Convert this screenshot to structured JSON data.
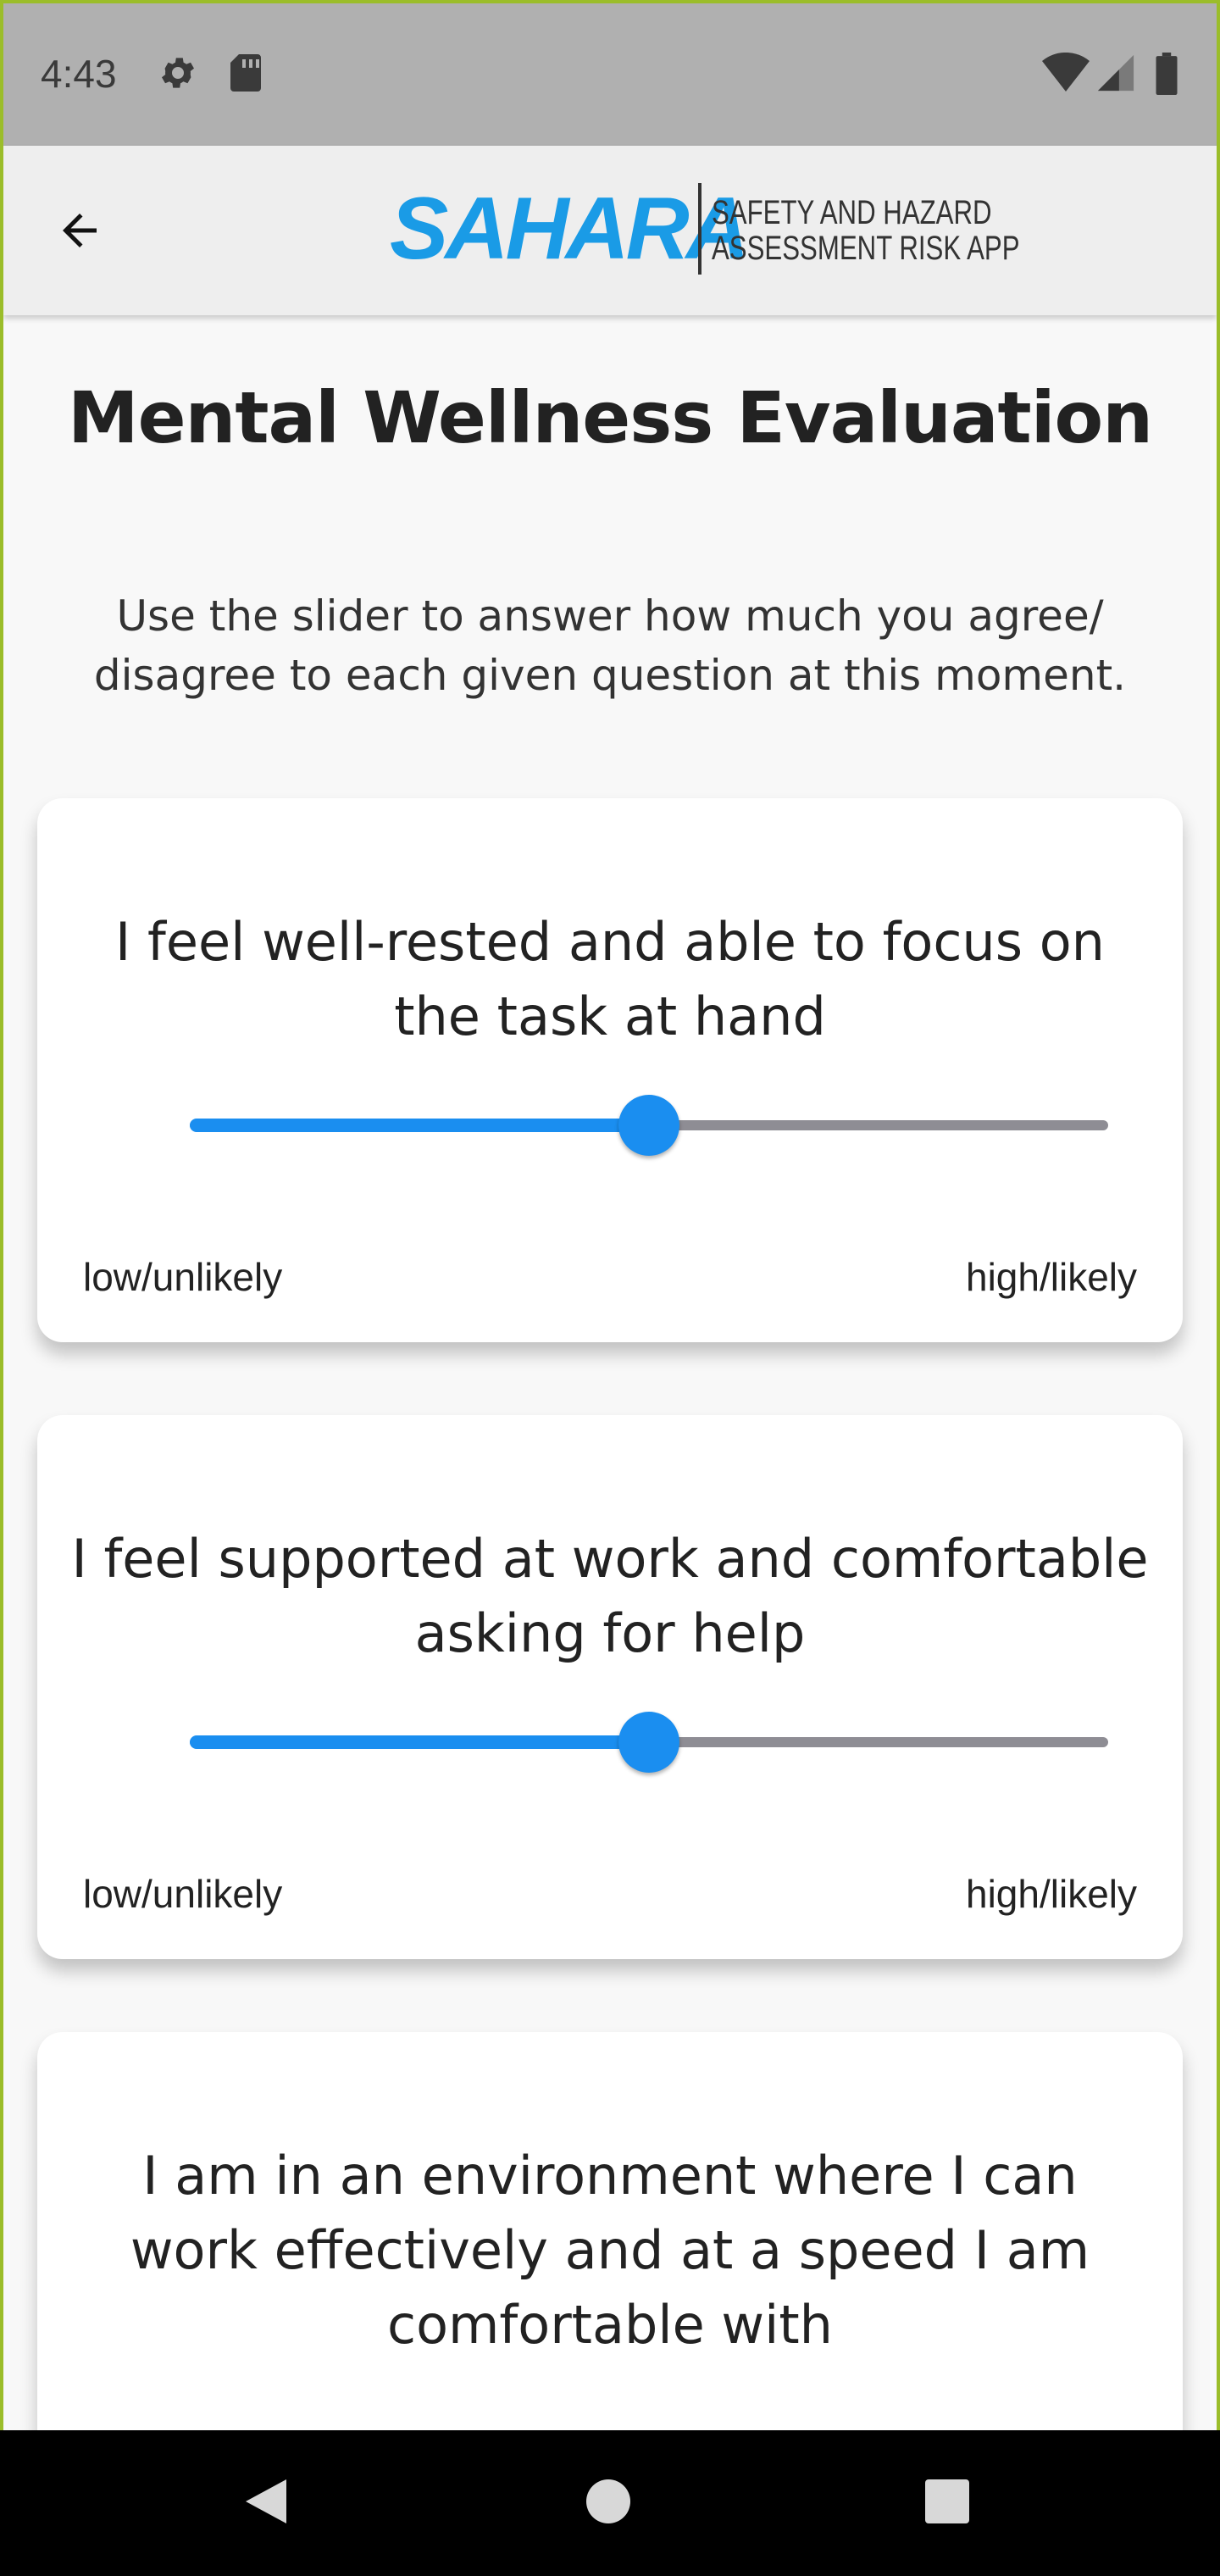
{
  "status_bar": {
    "time": "4:43",
    "icons": [
      "gear-icon",
      "sdcard-icon",
      "wifi-icon",
      "signal-icon",
      "battery-icon"
    ]
  },
  "app_bar": {
    "back_icon": "arrow-left-icon",
    "logo_text": "SAHARA",
    "logo_tagline_line1": "SAFETY AND HAZARD",
    "logo_tagline_line2": "ASSESSMENT RISK APP"
  },
  "page": {
    "title": "Mental Wellness Evaluation",
    "instructions": "Use the slider to answer how much you agree/ disagree to each given question at this moment."
  },
  "questions": [
    {
      "text": "I feel well-rested and able to focus on the task at hand",
      "slider_value": 0.5,
      "low_label": "low/unlikely",
      "high_label": "high/likely"
    },
    {
      "text": "I feel supported at work and comfortable asking for help",
      "slider_value": 0.5,
      "low_label": "low/unlikely",
      "high_label": "high/likely"
    },
    {
      "text": "I am in an environment where I can work effectively and at a speed I am comfortable with"
    }
  ],
  "colors": {
    "accent": "#1a8ef0",
    "logo": "#1a9be6",
    "inactive_track": "#8e8d94",
    "status_bar": "#b0b0b0",
    "app_bar": "#eeeeee"
  },
  "nav_bar": {
    "icons": [
      "back-triangle-icon",
      "home-circle-icon",
      "recents-square-icon"
    ]
  }
}
